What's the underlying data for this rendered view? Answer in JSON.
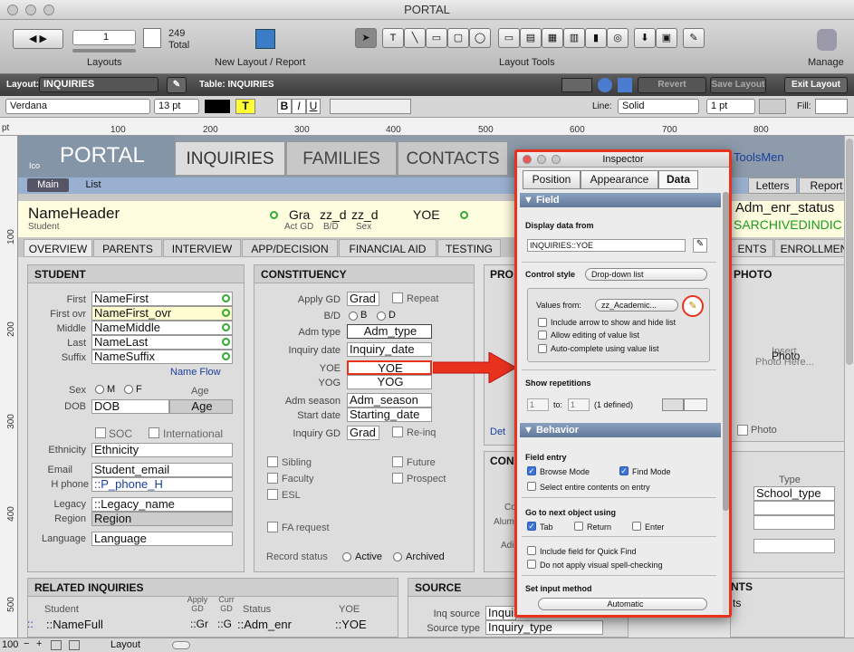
{
  "window": {
    "title": "PORTAL"
  },
  "toolbar": {
    "record_field": "1",
    "count": "249",
    "count_label": "Total",
    "layouts_label": "Layouts",
    "new_layout_label": "New Layout / Report",
    "layout_tools_label": "Layout Tools",
    "manage_label": "Manage"
  },
  "layout_bar": {
    "layout_label": "Layout:",
    "layout_value": "INQUIRIES",
    "table_label": "Table: INQUIRIES",
    "revert": "Revert",
    "save": "Save Layout",
    "exit": "Exit Layout"
  },
  "format_bar": {
    "font": "Verdana",
    "size": "13 pt",
    "bold": "B",
    "italic": "I",
    "underline": "U",
    "text_color": "T",
    "line_label": "Line:",
    "line_style": "Solid",
    "line_width": "1 pt",
    "fill_label": "Fill:"
  },
  "ruler": {
    "unit": "pt",
    "marks": [
      "100",
      "200",
      "300",
      "400",
      "500",
      "600",
      "700",
      "800"
    ],
    "vmarks": [
      "100",
      "200",
      "300",
      "400",
      "500"
    ]
  },
  "header": {
    "logo": "PORTAL",
    "ico": "Ico",
    "tabs": [
      "INQUIRIES",
      "FAMILIES",
      "CONTACTS"
    ],
    "tools_menu": "ToolsMen",
    "main_tab": "Main",
    "list_tab": "List",
    "letters": "Letters",
    "report": "Report"
  },
  "name_row": {
    "name": "NameHeader",
    "student": "Student",
    "grad": "Gra",
    "zz1": "zz_d",
    "zz2": "zz_d",
    "yoe": "YOE",
    "act_gd": "Act GD",
    "bd": "B/D",
    "sex": "Sex",
    "enr_status": "Adm_enr_status",
    "archived": "SARCHIVEDINDIC"
  },
  "subtabs": [
    "OVERVIEW",
    "PARENTS",
    "INTERVIEW",
    "APP/DECISION",
    "FINANCIAL AID",
    "TESTING",
    "ENTS",
    "ENROLLMEN"
  ],
  "student": {
    "title": "STUDENT",
    "rows": [
      {
        "label": "First",
        "value": "NameFirst"
      },
      {
        "label": "First ovr",
        "value": "NameFirst_ovr"
      },
      {
        "label": "Middle",
        "value": "NameMiddle"
      },
      {
        "label": "Last",
        "value": "NameLast"
      },
      {
        "label": "Suffix",
        "value": "NameSuffix"
      }
    ],
    "name_flow": "Name Flow",
    "sex": "Sex",
    "m": "M",
    "f": "F",
    "age_label": "Age",
    "dob_label": "DOB",
    "dob": "DOB",
    "age": "Age",
    "soc": "SOC",
    "international": "International",
    "ethnicity_label": "Ethnicity",
    "ethnicity": "Ethnicity",
    "email_label": "Email",
    "email": "Student_email",
    "hphone_label": "H phone",
    "hphone": "::P_phone_H",
    "legacy_label": "Legacy",
    "legacy": "::Legacy_name",
    "region_label": "Region",
    "region": "Region",
    "language_label": "Language",
    "language": "Language"
  },
  "constituency": {
    "title": "CONSTITUENCY",
    "apply_gd": "Apply GD",
    "grad": "Grad",
    "repeat": "Repeat",
    "bd": "B/D",
    "b": "B",
    "d": "D",
    "adm_type_label": "Adm type",
    "adm_type": "Adm_type",
    "inq_date_label": "Inquiry date",
    "inq_date": "Inquiry_date",
    "yoe_label": "YOE",
    "yoe": "YOE",
    "yog_label": "YOG",
    "yog": "YOG",
    "adm_season_label": "Adm season",
    "adm_season": "Adm_season",
    "start_label": "Start date",
    "start": "Starting_date",
    "inq_gd": "Inquiry GD",
    "grad2": "Grad",
    "reinq": "Re-inq",
    "sibling": "Sibling",
    "future": "Future",
    "faculty": "Faculty",
    "prospect": "Prospect",
    "esl": "ESL",
    "fa_request": "FA request",
    "record_status": "Record status",
    "active": "Active",
    "archived": "Archived"
  },
  "other": {
    "pro": "PRO",
    "con": "CON",
    "det": "Det",
    "co": "Co",
    "alum": "Alum",
    "adi": "Adi",
    "photo_title": "PHOTO",
    "insert": "Insert",
    "photo_here": "Photo Here...",
    "photo": "Photo",
    "photo_chk": "Photo",
    "type": "Type",
    "school_type": "School_type",
    "nts": "NTS",
    "ts": "ts"
  },
  "related": {
    "title": "RELATED INQUIRIES",
    "student": "Student",
    "apply_gd": "Apply GD",
    "curr_gd": "Curr GD",
    "status": "Status",
    "yoe": "YOE",
    "row": [
      "::NameFull",
      "::Gr",
      "::G",
      "::Adm_enr",
      "::YOE"
    ]
  },
  "source": {
    "title": "SOURCE",
    "inq_source_label": "Inq source",
    "inq_source": "Inquiry_Inn",
    "source_type_label": "Source type",
    "source_type": "Inquiry_type"
  },
  "inspector": {
    "title": "Inspector",
    "tabs": [
      "Position",
      "Appearance",
      "Data"
    ],
    "field_hd": "Field",
    "display_from": "Display data from",
    "display_value": "INQUIRIES::YOE",
    "control_style": "Control style",
    "control_value": "Drop-down list",
    "values_from": "Values from:",
    "values_value": "zz_Academic...",
    "opt1": "Include arrow to show and hide list",
    "opt2": "Allow editing of value list",
    "opt3": "Auto-complete using value list",
    "show_rep": "Show repetitions",
    "rep_from": "1",
    "to": "to:",
    "rep_to": "1",
    "defined": "(1 defined)",
    "behavior_hd": "Behavior",
    "field_entry": "Field entry",
    "browse": "Browse Mode",
    "find": "Find Mode",
    "select_all": "Select entire contents on entry",
    "go_next": "Go to next object using",
    "tab": "Tab",
    "return": "Return",
    "enter": "Enter",
    "quick_find": "Include field for Quick Find",
    "spell": "Do not apply visual spell-checking",
    "input_method": "Set input method",
    "input_value": "Automatic"
  },
  "status_bar": {
    "zoom": "100",
    "mode": "Layout"
  },
  "colors": {
    "highlight": "#e8321e",
    "accent": "#3d74d6"
  }
}
